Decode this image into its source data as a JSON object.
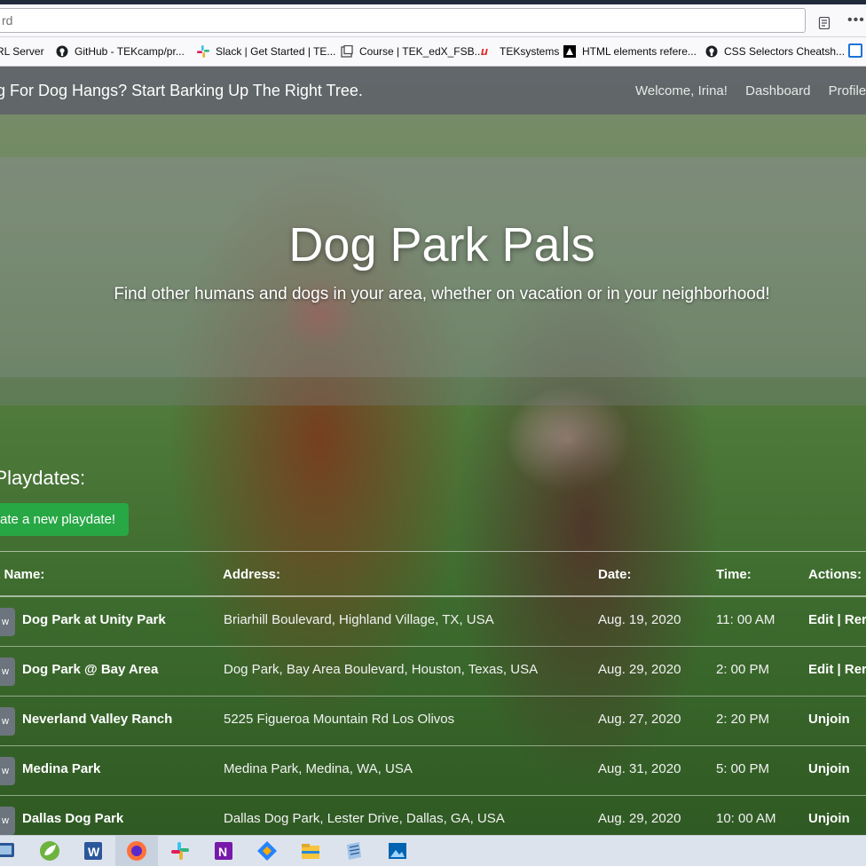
{
  "browser": {
    "url_text": "rd",
    "bookmarks": [
      {
        "label": "RL Server",
        "icon": "none"
      },
      {
        "label": "GitHub - TEKcamp/pr...",
        "icon": "github-icon"
      },
      {
        "label": "Slack | Get Started | TE...",
        "icon": "slack-icon"
      },
      {
        "label": "Course | TEK_edX_FSB...",
        "icon": "course-icon"
      },
      {
        "label": "TEKsystems",
        "icon": "teksystems-icon"
      },
      {
        "label": "HTML elements refere...",
        "icon": "mdn-icon"
      },
      {
        "label": "CSS Selectors Cheatsh...",
        "icon": "github-icon"
      }
    ]
  },
  "navbar": {
    "brand": "g For Dog Hangs? Start Barking Up The Right Tree.",
    "links": [
      "Welcome, Irina!",
      "Dashboard",
      "Profile"
    ]
  },
  "hero": {
    "title": "Dog Park Pals",
    "subtitle": "Find other humans and dogs in your area, whether on vacation or in your neighborhood!"
  },
  "playdates": {
    "heading": "r Playdates:",
    "create_label": "ate a new playdate!",
    "columns": [
      "k Name:",
      "Address:",
      "Date:",
      "Time:",
      "Actions:"
    ],
    "view_label": "w",
    "rows": [
      {
        "name": "Dog Park at Unity Park",
        "address": "Briarhill Boulevard, Highland Village, TX, USA",
        "date": "Aug. 19, 2020",
        "time": "11: 00 AM",
        "actions": "Edit | Rer"
      },
      {
        "name": "Dog Park @ Bay Area",
        "address": "Dog Park, Bay Area Boulevard, Houston, Texas, USA",
        "date": "Aug. 29, 2020",
        "time": "2: 00 PM",
        "actions": "Edit | Rer"
      },
      {
        "name": "Neverland Valley Ranch",
        "address": "5225 Figueroa Mountain Rd Los Olivos",
        "date": "Aug. 27, 2020",
        "time": "2: 20 PM",
        "actions": "Unjoin"
      },
      {
        "name": "Medina Park",
        "address": "Medina Park, Medina, WA, USA",
        "date": "Aug. 31, 2020",
        "time": "5: 00 PM",
        "actions": "Unjoin"
      },
      {
        "name": "Dallas Dog Park",
        "address": "Dallas Dog Park, Lester Drive, Dallas, GA, USA",
        "date": "Aug. 29, 2020",
        "time": "10: 00 AM",
        "actions": "Unjoin"
      }
    ]
  },
  "taskbar": {
    "apps": [
      "remote-app-icon",
      "spring-icon",
      "word-icon",
      "firefox-icon",
      "slack-icon",
      "onenote-icon",
      "jira-icon",
      "file-explorer-icon",
      "notepad-icon",
      "photos-icon"
    ]
  }
}
